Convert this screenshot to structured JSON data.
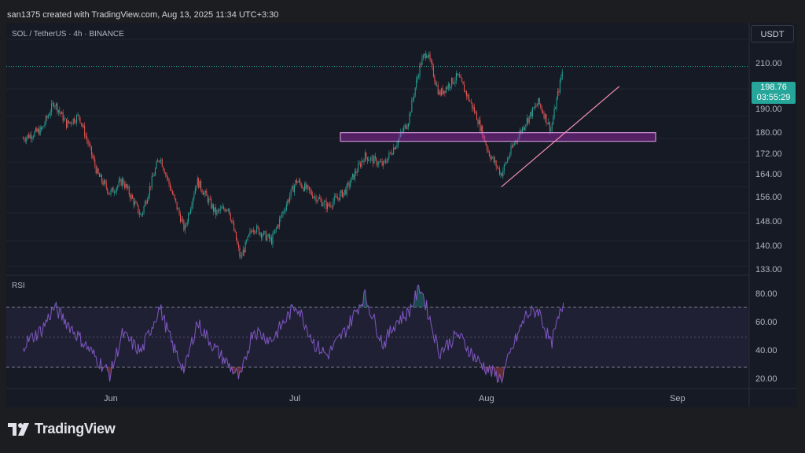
{
  "header": {
    "text": "san1375 created with TradingView.com, Aug 13, 2025 11:34 UTC+3:30"
  },
  "symbol": {
    "text": "SOL / TetherUS · 4h · BINANCE"
  },
  "currency_button": {
    "label": "USDT"
  },
  "price_axis": [
    "210.00",
    "190.00",
    "180.00",
    "172.00",
    "164.00",
    "156.00",
    "148.00",
    "140.00",
    "133.00"
  ],
  "last_price": {
    "value": "198.76",
    "countdown": "03:55:29"
  },
  "rsi": {
    "label": "RSI",
    "axis": [
      "80.00",
      "60.00",
      "40.00",
      "20.00"
    ]
  },
  "time_axis": [
    "Jun",
    "Jul",
    "Aug",
    "Sep"
  ],
  "brand": {
    "name": "TradingView"
  },
  "colors": {
    "up": "#26a69a",
    "down": "#ef5350",
    "zone": "#9c27b0",
    "trendline": "#f48fb1",
    "rsi_line": "#7e57c2",
    "price_tag": "#26a69a"
  },
  "chart_data": [
    {
      "type": "candlestick",
      "title": "SOL / TetherUS · 4h · BINANCE",
      "y_scale": "log",
      "ylim": [
        131,
        215
      ],
      "x_ticks": [
        "Jun",
        "Jul",
        "Aug",
        "Sep"
      ],
      "y_ticks": [
        210,
        190,
        180,
        172,
        164,
        156,
        148,
        140,
        133
      ],
      "close_path": [
        {
          "t": "May 18",
          "close": 172
        },
        {
          "t": "May 21",
          "close": 175
        },
        {
          "t": "May 23",
          "close": 185
        },
        {
          "t": "May 25",
          "close": 177
        },
        {
          "t": "May 27",
          "close": 180
        },
        {
          "t": "May 30",
          "close": 160
        },
        {
          "t": "Jun 1",
          "close": 154
        },
        {
          "t": "Jun 3",
          "close": 158
        },
        {
          "t": "Jun 6",
          "close": 147
        },
        {
          "t": "Jun 9",
          "close": 166
        },
        {
          "t": "Jun 11",
          "close": 154
        },
        {
          "t": "Jun 13",
          "close": 143
        },
        {
          "t": "Jun 15",
          "close": 158
        },
        {
          "t": "Jun 18",
          "close": 148
        },
        {
          "t": "Jun 20",
          "close": 150
        },
        {
          "t": "Jun 22",
          "close": 135
        },
        {
          "t": "Jun 24",
          "close": 144
        },
        {
          "t": "Jun 27",
          "close": 140
        },
        {
          "t": "Jul 1",
          "close": 158
        },
        {
          "t": "Jul 4",
          "close": 153
        },
        {
          "t": "Jul 6",
          "close": 150
        },
        {
          "t": "Jul 9",
          "close": 155
        },
        {
          "t": "Jul 12",
          "close": 166
        },
        {
          "t": "Jul 15",
          "close": 163
        },
        {
          "t": "Jul 17",
          "close": 170
        },
        {
          "t": "Jul 19",
          "close": 178
        },
        {
          "t": "Jul 21",
          "close": 200
        },
        {
          "t": "Jul 22",
          "close": 205
        },
        {
          "t": "Jul 24",
          "close": 188
        },
        {
          "t": "Jul 27",
          "close": 195
        },
        {
          "t": "Jul 30",
          "close": 180
        },
        {
          "t": "Aug 1",
          "close": 167
        },
        {
          "t": "Aug 3",
          "close": 160
        },
        {
          "t": "Aug 5",
          "close": 170
        },
        {
          "t": "Aug 7",
          "close": 178
        },
        {
          "t": "Aug 9",
          "close": 185
        },
        {
          "t": "Aug 11",
          "close": 175
        },
        {
          "t": "Aug 13",
          "close": 198.76
        }
      ],
      "support_zone": [
        171,
        174
      ],
      "trendline": [
        {
          "t": "Aug 3",
          "price": 156
        },
        {
          "t": "Aug 22",
          "price": 191
        }
      ]
    },
    {
      "type": "line",
      "series": [
        {
          "name": "RSI",
          "points": [
            {
              "t": "May 18",
              "rsi": 45
            },
            {
              "t": "May 21",
              "rsi": 55
            },
            {
              "t": "May 23",
              "rsi": 70
            },
            {
              "t": "May 27",
              "rsi": 50
            },
            {
              "t": "May 30",
              "rsi": 35
            },
            {
              "t": "Jun 1",
              "rsi": 25
            },
            {
              "t": "Jun 3",
              "rsi": 52
            },
            {
              "t": "Jun 6",
              "rsi": 40
            },
            {
              "t": "Jun 9",
              "rsi": 70
            },
            {
              "t": "Jun 11",
              "rsi": 45
            },
            {
              "t": "Jun 13",
              "rsi": 28
            },
            {
              "t": "Jun 15",
              "rsi": 60
            },
            {
              "t": "Jun 18",
              "rsi": 42
            },
            {
              "t": "Jun 22",
              "rsi": 22
            },
            {
              "t": "Jun 24",
              "rsi": 55
            },
            {
              "t": "Jun 27",
              "rsi": 48
            },
            {
              "t": "Jul 1",
              "rsi": 72
            },
            {
              "t": "Jul 4",
              "rsi": 45
            },
            {
              "t": "Jul 6",
              "rsi": 38
            },
            {
              "t": "Jul 9",
              "rsi": 55
            },
            {
              "t": "Jul 12",
              "rsi": 78
            },
            {
              "t": "Jul 15",
              "rsi": 45
            },
            {
              "t": "Jul 17",
              "rsi": 60
            },
            {
              "t": "Jul 19",
              "rsi": 66
            },
            {
              "t": "Jul 21",
              "rsi": 84
            },
            {
              "t": "Jul 24",
              "rsi": 40
            },
            {
              "t": "Jul 27",
              "rsi": 52
            },
            {
              "t": "Jul 30",
              "rsi": 35
            },
            {
              "t": "Aug 1",
              "rsi": 28
            },
            {
              "t": "Aug 3",
              "rsi": 22
            },
            {
              "t": "Aug 5",
              "rsi": 45
            },
            {
              "t": "Aug 7",
              "rsi": 65
            },
            {
              "t": "Aug 9",
              "rsi": 68
            },
            {
              "t": "Aug 11",
              "rsi": 45
            },
            {
              "t": "Aug 13",
              "rsi": 73
            }
          ]
        }
      ],
      "ylim": [
        18,
        87
      ],
      "y_ticks": [
        80,
        60,
        40,
        20
      ],
      "band": [
        30,
        70
      ],
      "midline": 50
    }
  ]
}
